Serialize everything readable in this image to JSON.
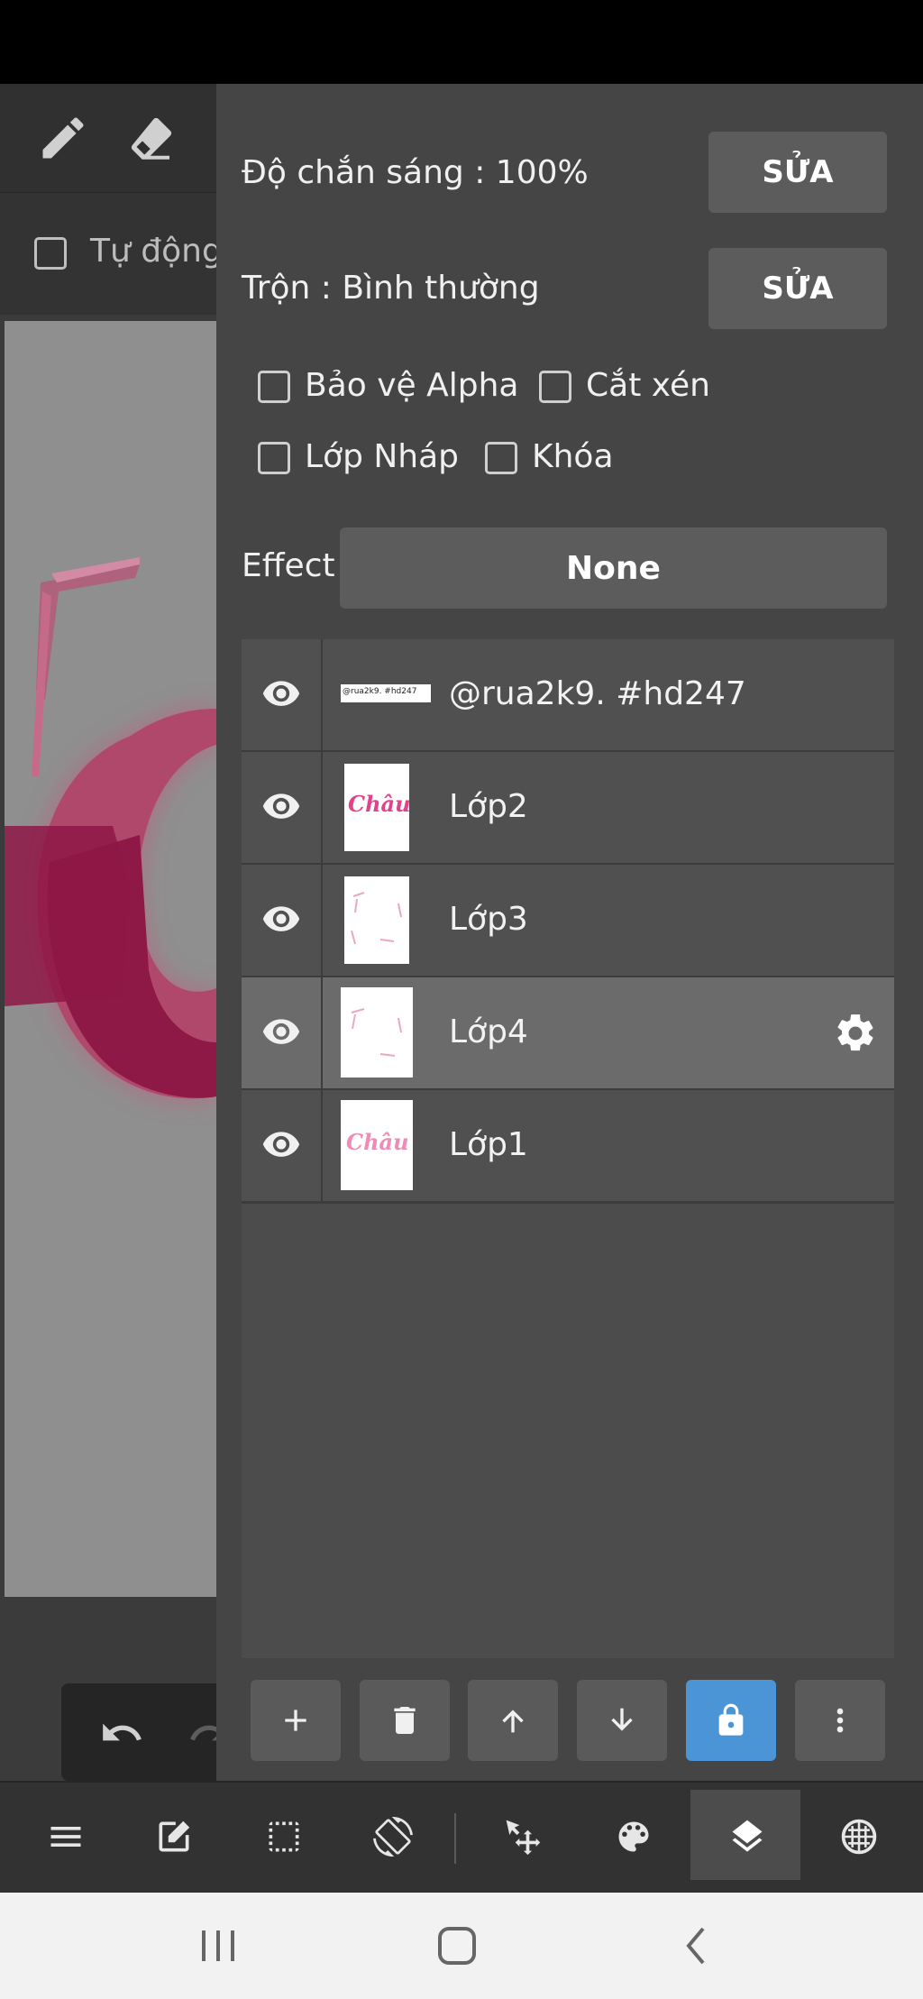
{
  "toolbar": {
    "auto_label": "Tự động"
  },
  "layer_panel": {
    "opacity_label": "Độ chắn sáng : 100%",
    "blend_label": "Trộn : Bình thường",
    "edit_label": "SỬA",
    "protect_alpha_label": "Bảo vệ Alpha",
    "clipping_label": "Cắt xén",
    "draft_layer_label": "Lớp Nháp",
    "lock_label": "Khóa",
    "effect_label": "Effect",
    "effect_value": "None",
    "layers": [
      {
        "name": "@rua2k9.   #hd247",
        "thumb_text": "@rua2k9. #hd247",
        "selected": false
      },
      {
        "name": "Lớp2",
        "thumb_text": "Châu",
        "selected": false
      },
      {
        "name": "Lớp3",
        "thumb_text": "",
        "selected": false
      },
      {
        "name": "Lớp4",
        "thumb_text": "",
        "selected": true
      },
      {
        "name": "Lớp1",
        "thumb_text": "Châu",
        "selected": false
      }
    ]
  },
  "colors": {
    "panel_bg": "#454545",
    "selected_row": "#6b6b6b",
    "lock_active": "#4b95d6",
    "canvas_pink": "#8e1846"
  },
  "icons": {
    "toolbar": [
      "pencil-icon",
      "eraser-icon"
    ],
    "panel_toolbar": [
      "plus-icon",
      "trash-icon",
      "arrow-up-icon",
      "arrow-down-icon",
      "lock-icon",
      "more-vert-icon"
    ],
    "bottom_bar": [
      "menu-icon",
      "edit-icon",
      "selection-icon",
      "rotate-screen-icon",
      "move-icon",
      "palette-icon",
      "layers-icon",
      "grid-icon"
    ],
    "nav_bar": [
      "recents-icon",
      "home-icon",
      "back-icon"
    ]
  }
}
